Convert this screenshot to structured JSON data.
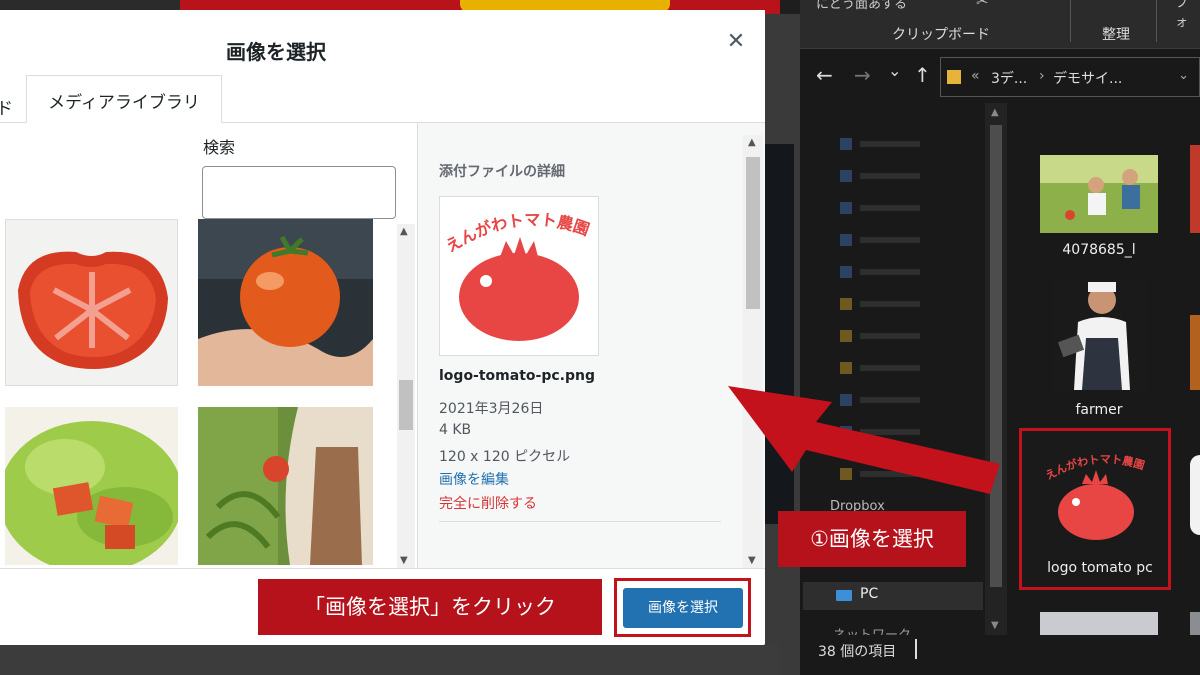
{
  "modal": {
    "title": "画像を選択",
    "close_glyph": "✕",
    "tabs": {
      "upload_fragment": "ド",
      "library": "メディアライブラリ"
    },
    "search_label": "検索",
    "search_value": "",
    "details": {
      "heading": "添付ファイルの詳細",
      "preview_logo_text": "えんがわトマト農園",
      "filename": "logo-tomato-pc.png",
      "date": "2021年3月26日",
      "size": "4 KB",
      "dimensions": "120 x 120 ピクセル",
      "edit_link": "画像を編集",
      "delete_link": "完全に削除する"
    },
    "select_button": "画像を選択"
  },
  "callouts": {
    "click_hint": "「画像を選択」をクリック",
    "step1": "①画像を選択"
  },
  "explorer": {
    "ribbon": {
      "top_text": "にどう面あする",
      "clipboard": "クリップボード",
      "organize": "整理",
      "side_fragment": "フォ"
    },
    "nav": {
      "back": "←",
      "forward": "→",
      "dropdown": "⌄",
      "up": "↑"
    },
    "address": {
      "overflow": "«",
      "crumb1": "3デ...",
      "sep": "›",
      "crumb2": "デモサイ...",
      "chevron": "⌄"
    },
    "sidebar": {
      "dropbox": "Dropbox",
      "pc": "PC",
      "network": "ネットワーク"
    },
    "files": [
      {
        "label": "4078685_l"
      },
      {
        "label": "farmer"
      },
      {
        "label": "logo tomato pc",
        "logo_text": "えんがわトマト農園"
      }
    ],
    "status": "38 個の項目"
  },
  "colors": {
    "wp_primary": "#2271b1",
    "wp_delete": "#d63638",
    "annotation_red": "#b5121b",
    "logo_red": "#e84545"
  }
}
